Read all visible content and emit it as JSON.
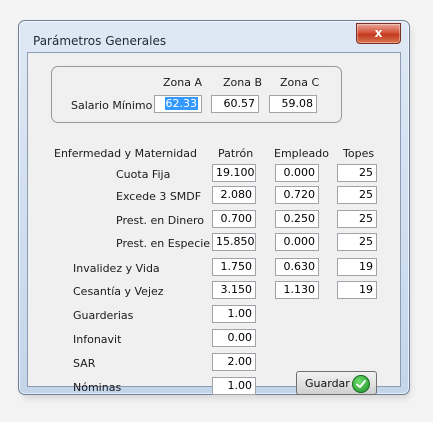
{
  "window": {
    "title": "Parámetros Generales",
    "close_label": "x"
  },
  "zones": {
    "headers": [
      "Zona A",
      "Zona B",
      "Zona C"
    ],
    "row_label": "Salario Mínimo",
    "values": [
      "62.33",
      "60.57",
      "59.08"
    ]
  },
  "columns": {
    "patron": "Patrón",
    "empleado": "Empleado",
    "topes": "Topes"
  },
  "section_label": "Enfermedad y Maternidad",
  "rows": [
    {
      "label": "Cuota Fija",
      "patron": "19.100",
      "empleado": "0.000",
      "tope": "25"
    },
    {
      "label": "Excede 3 SMDF",
      "patron": "2.080",
      "empleado": "0.720",
      "tope": "25"
    },
    {
      "label": "Prest. en Dinero",
      "patron": "0.700",
      "empleado": "0.250",
      "tope": "25"
    },
    {
      "label": "Prest. en Especie",
      "patron": "15.850",
      "empleado": "0.000",
      "tope": "25"
    },
    {
      "label": "Invalidez y Vida",
      "patron": "1.750",
      "empleado": "0.630",
      "tope": "19"
    },
    {
      "label": "Cesantía y Vejez",
      "patron": "3.150",
      "empleado": "1.130",
      "tope": "19"
    },
    {
      "label": "Guarderias",
      "patron": "1.00"
    },
    {
      "label": "Infonavit",
      "patron": "0.00"
    },
    {
      "label": "SAR",
      "patron": "2.00"
    },
    {
      "label": "Nóminas",
      "patron": "1.00"
    }
  ],
  "save_button": {
    "label": "Guardar",
    "icon": "check-icon"
  }
}
